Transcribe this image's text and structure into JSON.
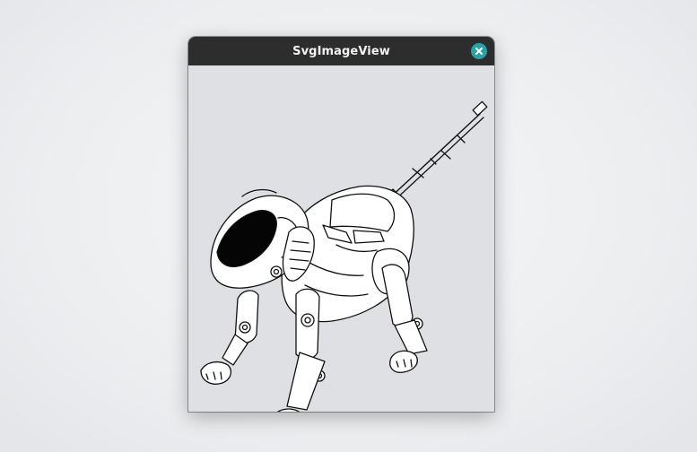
{
  "window": {
    "title": "SvgImageView"
  },
  "titlebar": {
    "close_icon": "close-x",
    "close_button_color": "#2aa0a7"
  },
  "content": {
    "image_subject": "robot-dog",
    "background_color": "#dfe0e4"
  }
}
